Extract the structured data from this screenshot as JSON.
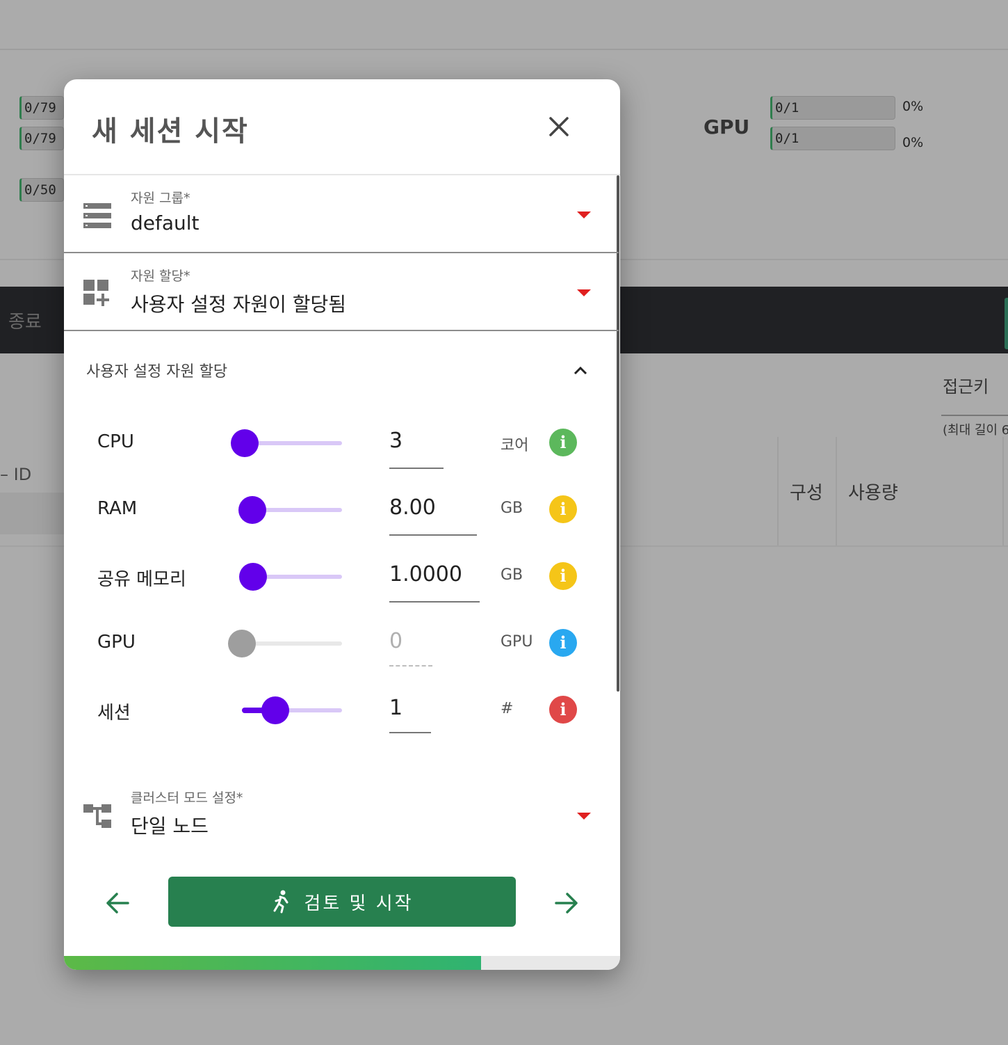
{
  "background": {
    "left_counters": [
      "0/79",
      "0/79",
      "0/50"
    ],
    "gpu_title": "GPU",
    "gpu_counters": [
      "0/1",
      "0/1"
    ],
    "gpu_percents": [
      "0%",
      "0%"
    ],
    "end_label": "종료",
    "access_key_label": "접근키",
    "max_length_note": "(최대 길이 6",
    "id_label": "ID",
    "col_config": "구성",
    "col_usage": "사용량"
  },
  "dialog": {
    "title": "새 세션 시작",
    "close_icon": "close-icon",
    "resource_group": {
      "label": "자원 그룹*",
      "value": "default",
      "icon": "list-icon"
    },
    "resource_allocation": {
      "label": "자원 할당*",
      "value": "사용자 설정 자원이 할당됨",
      "icon": "dashboard-add-icon"
    },
    "custom_section": {
      "title": "사용자 설정 자원 할당",
      "expanded": true
    },
    "resources": [
      {
        "key": "cpu",
        "label": "CPU",
        "value": "3",
        "unit": "코어",
        "slider_fraction": 0.0,
        "info_color": "#5cb85c"
      },
      {
        "key": "ram",
        "label": "RAM",
        "value": "8.00",
        "unit": "GB",
        "slider_fraction": 0.0,
        "info_color": "#f5c518"
      },
      {
        "key": "shmem",
        "label": "공유 메모리",
        "value": "1.0000",
        "unit": "GB",
        "slider_fraction": 0.0,
        "info_color": "#f5c518"
      },
      {
        "key": "gpu",
        "label": "GPU",
        "value": "0",
        "unit": "GPU",
        "slider_fraction": 0.0,
        "disabled": true,
        "info_color": "#29a8f0"
      },
      {
        "key": "session",
        "label": "세션",
        "value": "1",
        "unit": "#",
        "slider_fraction": 0.33,
        "info_color": "#e04848"
      }
    ],
    "cluster_mode": {
      "label": "클러스터 모드 설정*",
      "value": "단일 노드",
      "icon": "cluster-icon"
    },
    "start_button": {
      "label": "검토 및 시작",
      "icon": "runner-icon"
    },
    "progress_fraction": 0.75,
    "colors": {
      "accent": "#6200ea",
      "primary_green": "#27804f",
      "caret_red": "#e02020"
    }
  }
}
